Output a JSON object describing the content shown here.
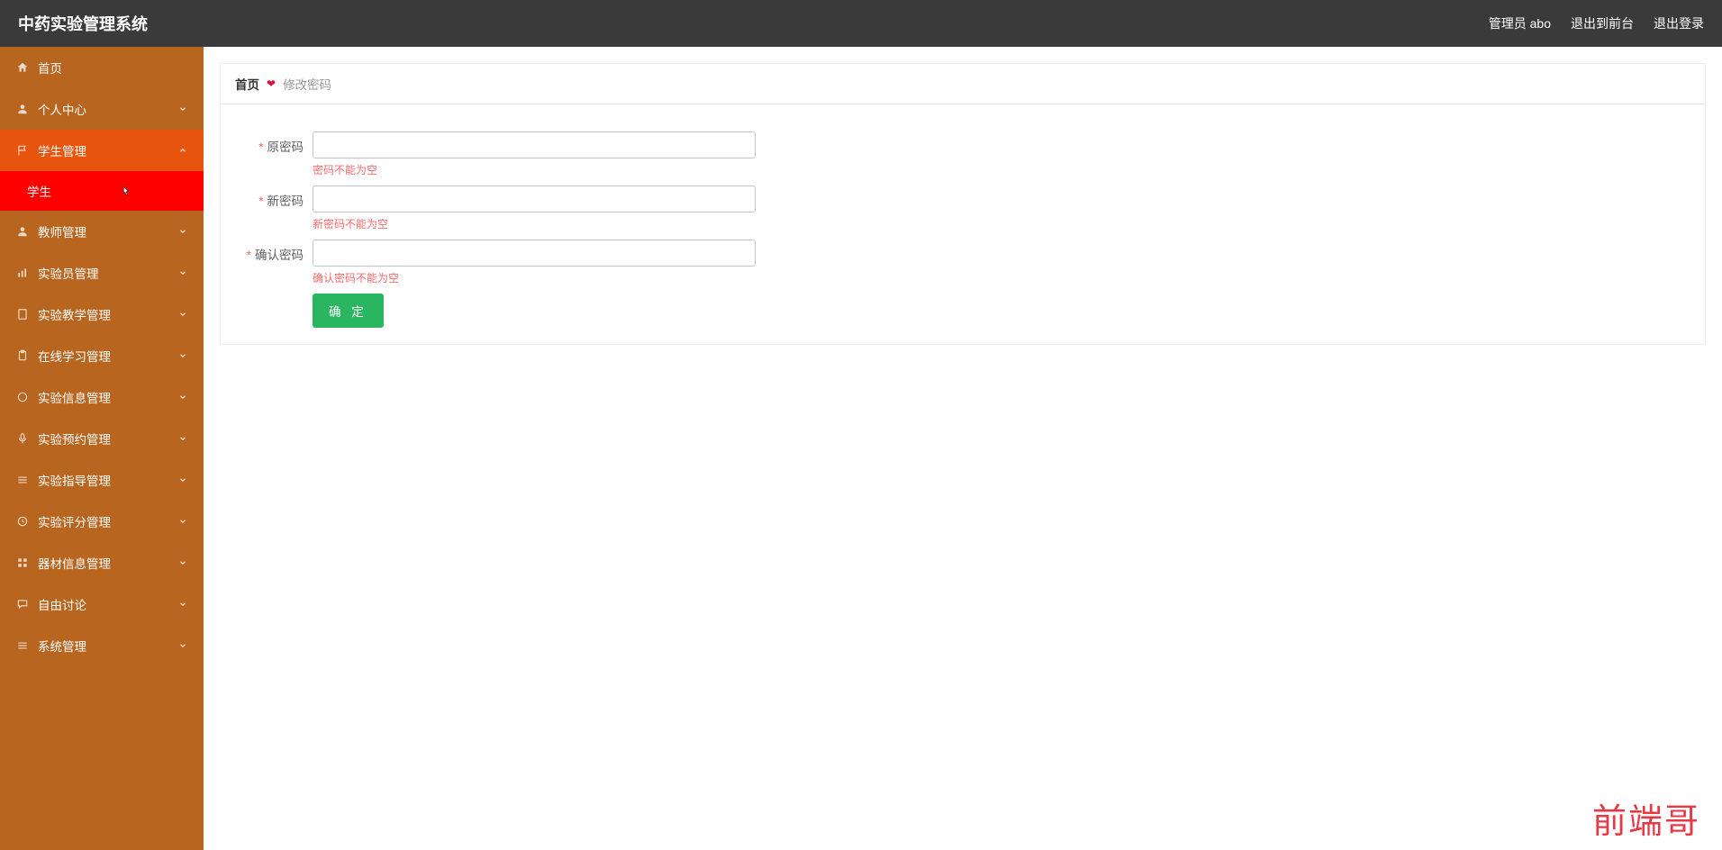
{
  "header": {
    "title": "中药实验管理系统",
    "user_label": "管理员 abo",
    "exit_front": "退出到前台",
    "logout": "退出登录"
  },
  "sidebar": {
    "items": [
      {
        "label": "首页",
        "icon": "house-icon",
        "expandable": false
      },
      {
        "label": "个人中心",
        "icon": "user-icon",
        "expandable": true
      },
      {
        "label": "学生管理",
        "icon": "flag-icon",
        "expandable": true,
        "active": true
      },
      {
        "label": "教师管理",
        "icon": "user-icon",
        "expandable": true
      },
      {
        "label": "实验员管理",
        "icon": "bars-icon",
        "expandable": true
      },
      {
        "label": "实验教学管理",
        "icon": "doc-icon",
        "expandable": true
      },
      {
        "label": "在线学习管理",
        "icon": "clipboard-icon",
        "expandable": true
      },
      {
        "label": "实验信息管理",
        "icon": "circle-icon",
        "expandable": true
      },
      {
        "label": "实验预约管理",
        "icon": "mic-icon",
        "expandable": true
      },
      {
        "label": "实验指导管理",
        "icon": "list-icon",
        "expandable": true
      },
      {
        "label": "实验评分管理",
        "icon": "clock-icon",
        "expandable": true
      },
      {
        "label": "器材信息管理",
        "icon": "grid-icon",
        "expandable": true
      },
      {
        "label": "自由讨论",
        "icon": "chat-icon",
        "expandable": true
      },
      {
        "label": "系统管理",
        "icon": "list-icon",
        "expandable": true
      }
    ],
    "submenu_student": "学生"
  },
  "breadcrumb": {
    "home": "首页",
    "current": "修改密码"
  },
  "form": {
    "old_password_label": "原密码",
    "old_password_error": "密码不能为空",
    "new_password_label": "新密码",
    "new_password_error": "新密码不能为空",
    "confirm_password_label": "确认密码",
    "confirm_password_error": "确认密码不能为空",
    "confirm_button": "确 定"
  },
  "watermark": "前端哥"
}
